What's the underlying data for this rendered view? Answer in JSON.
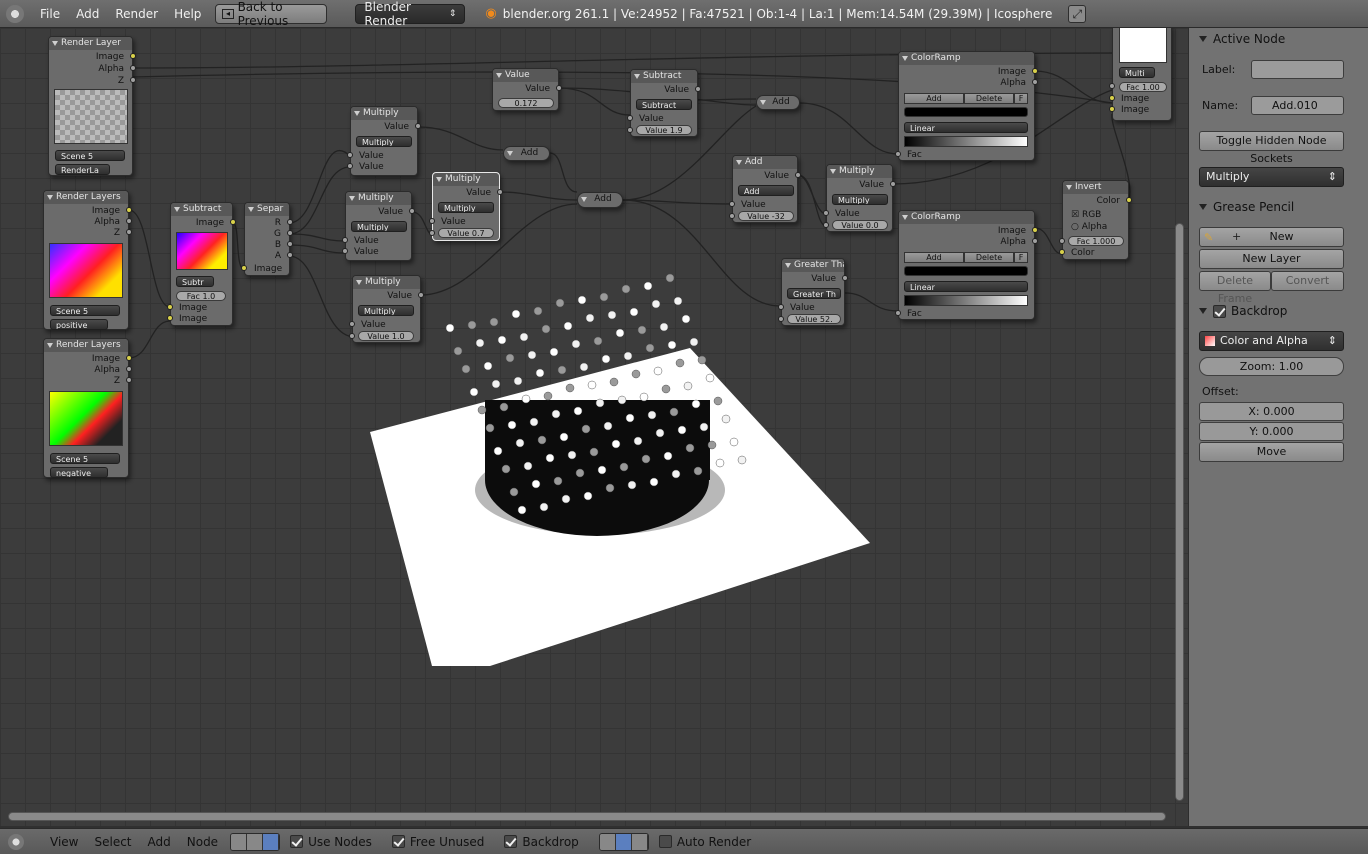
{
  "topbar": {
    "menus": [
      "File",
      "Add",
      "Render",
      "Help"
    ],
    "back_button": "Back to Previous",
    "render_engine": "Blender Render",
    "stats": "blender.org 261.1 | Ve:24952 | Fa:47521 | Ob:1-4 | La:1 | Mem:14.54M (29.39M) | Icosphere"
  },
  "nodes": {
    "render_layers_1": {
      "title": "Render Layer",
      "out_image": "Image",
      "out_alpha": "Alpha",
      "out_z": "Z",
      "scene": "Scene",
      "scene_num": "5",
      "layer": "RenderLa"
    },
    "render_layers_2": {
      "title": "Render Layers",
      "out_image": "Image",
      "out_alpha": "Alpha",
      "out_z": "Z",
      "scene": "Scene",
      "scene_num": "5",
      "layer": "positive"
    },
    "render_layers_3": {
      "title": "Render Layers",
      "out_image": "Image",
      "out_alpha": "Alpha",
      "out_z": "Z",
      "scene": "Scene",
      "scene_num": "5",
      "layer": "negative"
    },
    "subtract_img": {
      "title": "Subtract",
      "out_image": "Image",
      "op": "Subtr",
      "fac": "Fac 1.0",
      "in_image1": "Image",
      "in_image2": "Image"
    },
    "separate": {
      "title": "Separ",
      "r": "R",
      "g": "G",
      "b": "B",
      "a": "A",
      "in_image": "Image"
    },
    "multiply_1": {
      "title": "Multiply",
      "out": "Value",
      "op": "Multiply",
      "in1": "Value",
      "in2": "Value"
    },
    "multiply_2": {
      "title": "Multiply",
      "out": "Value",
      "op": "Multiply",
      "in1": "Value",
      "in2": "Value"
    },
    "multiply_3": {
      "title": "Multiply",
      "out": "Value",
      "op": "Multiply",
      "in1": "Value",
      "field": "Value 0.7"
    },
    "multiply_4": {
      "title": "Multiply",
      "out": "Value",
      "op": "Multiply",
      "in1": "Value",
      "field": "Value 1.0"
    },
    "value": {
      "title": "Value",
      "out": "Value",
      "field": "0.172"
    },
    "subtract_val": {
      "title": "Subtract",
      "out": "Value",
      "op": "Subtract",
      "in1": "Value",
      "field": "Value 1.9"
    },
    "add_1": {
      "title": "Add"
    },
    "add_2": {
      "title": "Add"
    },
    "add_3": {
      "title": "Add"
    },
    "add_4": {
      "title": "Add",
      "out": "Value",
      "op": "Add",
      "in1": "Value",
      "field": "Value -32"
    },
    "multiply_5": {
      "title": "Multiply",
      "out": "Value",
      "op": "Multiply",
      "in1": "Value",
      "field": "Value 0.0"
    },
    "greater_than": {
      "title": "Greater Tha",
      "out": "Value",
      "op": "Greater Th",
      "in1": "Value",
      "field": "Value 52."
    },
    "colorramp_1": {
      "title": "ColorRamp",
      "out_image": "Image",
      "out_alpha": "Alpha",
      "add": "Add",
      "delete": "Delete",
      "f": "F",
      "interp": "Linear",
      "in_fac": "Fac"
    },
    "colorramp_2": {
      "title": "ColorRamp",
      "out_image": "Image",
      "out_alpha": "Alpha",
      "add": "Add",
      "delete": "Delete",
      "f": "F",
      "interp": "Linear",
      "in_fac": "Fac"
    },
    "invert": {
      "title": "Invert",
      "out": "Color",
      "rgb": "RGB",
      "alpha": "Alpha",
      "fac": "Fac 1.000",
      "in_color": "Color"
    },
    "composite": {
      "op": "Multi",
      "fac": "Fac 1.00",
      "in_image1": "Image",
      "in_image2": "Image"
    }
  },
  "sidebar": {
    "active_node_title": "Active Node",
    "label_label": "Label:",
    "label_value": "",
    "name_label": "Name:",
    "name_value": "Add.010",
    "toggle_hidden": "Toggle Hidden Node Sockets",
    "operation": "Multiply",
    "grease_pencil_title": "Grease Pencil",
    "new": "New",
    "new_layer": "New Layer",
    "delete_frame": "Delete Frame",
    "convert": "Convert",
    "backdrop_title": "Backdrop",
    "backdrop_mode": "Color and Alpha",
    "zoom": "Zoom: 1.00",
    "offset_label": "Offset:",
    "offset_x": "X: 0.000",
    "offset_y": "Y: 0.000",
    "move": "Move"
  },
  "bottombar": {
    "view": "View",
    "select": "Select",
    "add": "Add",
    "node": "Node",
    "use_nodes": "Use Nodes",
    "free_unused": "Free Unused",
    "backdrop": "Backdrop",
    "auto_render": "Auto Render"
  }
}
